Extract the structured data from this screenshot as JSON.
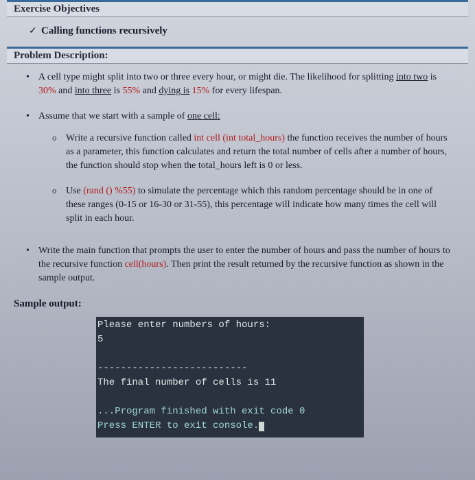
{
  "exercise_objectives": {
    "header": "Exercise Objectives",
    "items": [
      "Calling functions recursively"
    ]
  },
  "problem": {
    "header": "Problem Description:",
    "p1_a": "A cell type might split into two or three every hour, or might die.  The likelihood for splitting ",
    "p1_u1": "into two",
    "p1_b": " is ",
    "p1_r1": "30%",
    "p1_c": " and ",
    "p1_u2": "into three",
    "p1_d": " is ",
    "p1_r2": "55%",
    "p1_e": " and ",
    "p1_u3": "dying is",
    "p1_f": " ",
    "p1_r3": "15%",
    "p1_g": " for every lifespan.",
    "p2_a": "Assume that we start with a sample of ",
    "p2_u1": "one cell:",
    "sub1_a": "Write a recursive function called ",
    "sub1_r1": "int cell (int total_hours)",
    "sub1_b": " the function receives the number of hours as a parameter, this function calculates and return the total number of cells after a number of hours, the function should stop when the total_hours left is 0 or less.",
    "sub2_a": "Use ",
    "sub2_r1": "(rand () %55)",
    "sub2_b": " to simulate the percentage which this random percentage should be in one of these ranges (0-15 or 16-30 or 31-55), this percentage will indicate how many times the cell will split in each hour.",
    "p3_a": "Write the main function that prompts the user to enter the number of hours and pass the number of hours to the recursive function ",
    "p3_r1": "cell(hours)",
    "p3_b": ". Then print the result returned by the recursive function as shown in the sample output."
  },
  "sample": {
    "header": "Sample output:",
    "line1": "Please enter numbers of hours:",
    "line2": "5",
    "line3": "The final number of cells is 11",
    "line4a": "...Program finished with exit code 0",
    "line4b": "Press ENTER to exit console."
  }
}
